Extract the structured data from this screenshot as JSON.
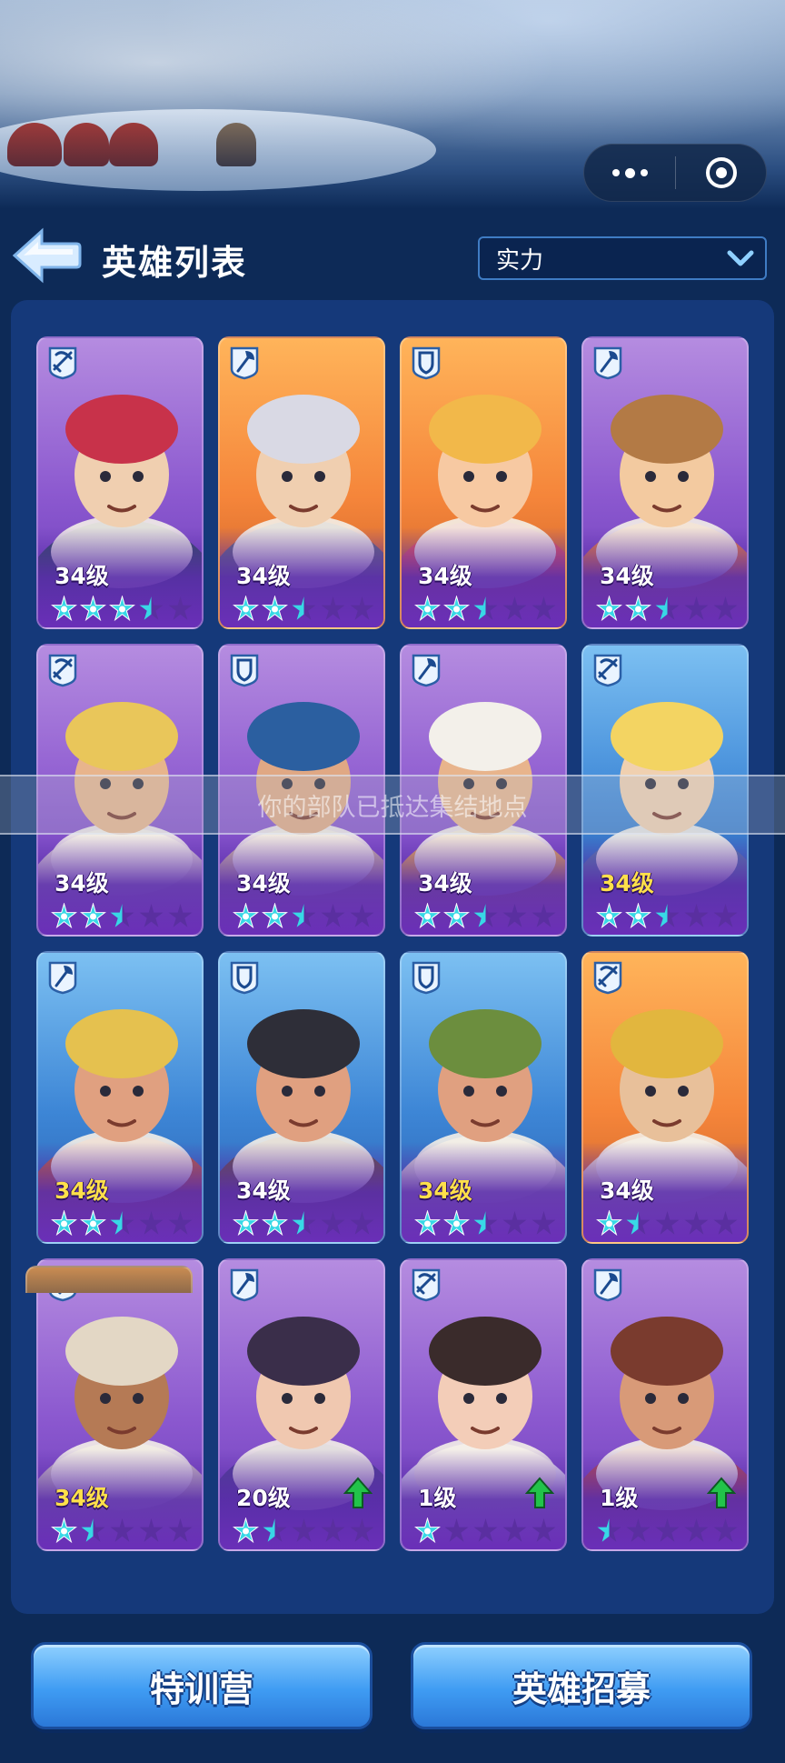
{
  "header": {
    "title": "英雄列表",
    "sort_value": "实力"
  },
  "toast": {
    "text": "你的部队已抵达集结地点"
  },
  "colors": {
    "background": "#0d2a57",
    "panel": "#15397a",
    "card_purple": "#8b58cf",
    "card_orange": "#f5853a",
    "card_blue": "#3d86d6",
    "star_active": "#38d8e6",
    "star_inactive": "#5a2fa0",
    "level_gold": "#ffe04a",
    "upgrade_arrow": "#22c34a"
  },
  "heroes": [
    {
      "level": "34级",
      "color": "purple",
      "role": "crossbow-icon",
      "stars": 3,
      "half": true,
      "max": 5,
      "gold": false,
      "upgrade": false
    },
    {
      "level": "34级",
      "color": "orange",
      "role": "axe-icon",
      "stars": 2,
      "half": true,
      "max": 5,
      "gold": false,
      "upgrade": false
    },
    {
      "level": "34级",
      "color": "orange",
      "role": "shield-icon",
      "stars": 2,
      "half": true,
      "max": 5,
      "gold": false,
      "upgrade": false
    },
    {
      "level": "34级",
      "color": "purple",
      "role": "axe-icon",
      "stars": 2,
      "half": true,
      "max": 5,
      "gold": false,
      "upgrade": false
    },
    {
      "level": "34级",
      "color": "purple",
      "role": "crossbow-icon",
      "stars": 2,
      "half": true,
      "max": 5,
      "gold": false,
      "upgrade": false
    },
    {
      "level": "34级",
      "color": "purple",
      "role": "shield-icon",
      "stars": 2,
      "half": true,
      "max": 5,
      "gold": false,
      "upgrade": false
    },
    {
      "level": "34级",
      "color": "purple",
      "role": "axe-icon",
      "stars": 2,
      "half": true,
      "max": 5,
      "gold": false,
      "upgrade": false
    },
    {
      "level": "34级",
      "color": "blue",
      "role": "crossbow-icon",
      "stars": 2,
      "half": true,
      "max": 5,
      "gold": true,
      "upgrade": false
    },
    {
      "level": "34级",
      "color": "blue",
      "role": "axe-icon",
      "stars": 2,
      "half": true,
      "max": 5,
      "gold": true,
      "upgrade": false
    },
    {
      "level": "34级",
      "color": "blue",
      "role": "shield-icon",
      "stars": 2,
      "half": true,
      "max": 5,
      "gold": false,
      "upgrade": false
    },
    {
      "level": "34级",
      "color": "blue",
      "role": "shield-icon",
      "stars": 2,
      "half": true,
      "max": 5,
      "gold": true,
      "upgrade": false
    },
    {
      "level": "34级",
      "color": "orange",
      "role": "crossbow-icon",
      "stars": 1,
      "half": true,
      "max": 5,
      "gold": false,
      "upgrade": false
    },
    {
      "level": "34级",
      "color": "purple",
      "role": "crossbow-icon",
      "stars": 1,
      "half": true,
      "max": 5,
      "gold": true,
      "upgrade": false
    },
    {
      "level": "20级",
      "color": "purple",
      "role": "axe-icon",
      "stars": 1,
      "half": true,
      "max": 5,
      "gold": false,
      "upgrade": true
    },
    {
      "level": "1级",
      "color": "purple",
      "role": "crossbow-icon",
      "stars": 1,
      "half": false,
      "max": 5,
      "gold": false,
      "upgrade": true
    },
    {
      "level": "1级",
      "color": "purple",
      "role": "axe-icon",
      "stars": 0,
      "half": true,
      "max": 5,
      "gold": false,
      "upgrade": true
    }
  ],
  "buttons": {
    "training_camp": "特训营",
    "hero_recruit": "英雄招募"
  }
}
